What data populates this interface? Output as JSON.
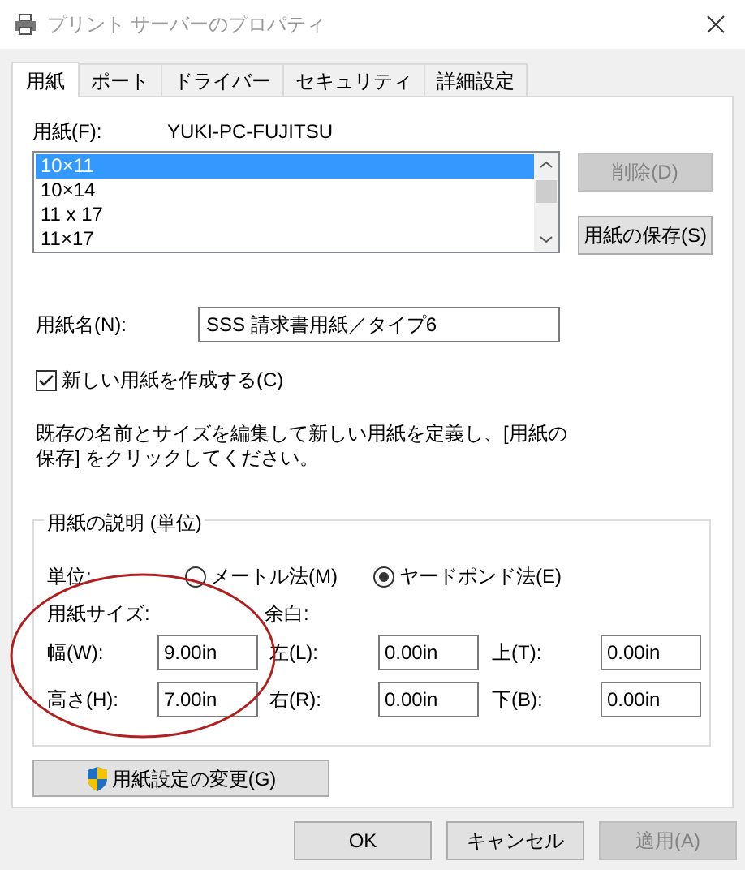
{
  "window": {
    "title": "プリント サーバーのプロパティ"
  },
  "tabs": [
    {
      "label": "用紙",
      "selected": true
    },
    {
      "label": "ポート",
      "selected": false
    },
    {
      "label": "ドライバー",
      "selected": false
    },
    {
      "label": "セキュリティ",
      "selected": false
    },
    {
      "label": "詳細設定",
      "selected": false
    }
  ],
  "paper_forms": {
    "label": "用紙(F):",
    "server": "YUKI-PC-FUJITSU"
  },
  "paper_list": [
    {
      "label": "10×11",
      "selected": true
    },
    {
      "label": "10×14",
      "selected": false
    },
    {
      "label": "11 x 17",
      "selected": false
    },
    {
      "label": "11×17",
      "selected": false
    }
  ],
  "side_buttons": [
    {
      "label": "削除(D)",
      "disabled": true
    },
    {
      "label": "用紙の保存(S)",
      "disabled": false
    }
  ],
  "paper_name": {
    "label": "用紙名(N):",
    "value": "SSS 請求書用紙／タイプ6"
  },
  "create_new": {
    "label": "新しい用紙を作成する(C)",
    "checked": true
  },
  "instructions": "既存の名前とサイズを編集して新しい用紙を定義し、[用紙の保存] をクリックしてください。",
  "description_group": {
    "title": "用紙の説明 (単位)",
    "unit_label": "単位:",
    "units": [
      {
        "label": "メートル法(M)",
        "selected": false
      },
      {
        "label": "ヤードポンド法(E)",
        "selected": true
      }
    ],
    "size_label": "用紙サイズ:",
    "margin_label": "余白:",
    "size_fields": [
      {
        "label": "幅(W):",
        "value": "9.00in"
      },
      {
        "label": "高さ(H):",
        "value": "7.00in"
      }
    ],
    "margin_fields": [
      {
        "label": "左(L):",
        "value": "0.00in"
      },
      {
        "label": "上(T):",
        "value": "0.00in"
      },
      {
        "label": "右(R):",
        "value": "0.00in"
      },
      {
        "label": "下(B):",
        "value": "0.00in"
      }
    ]
  },
  "change_settings_button": {
    "label": "用紙設定の変更(G)"
  },
  "dialog_buttons": [
    {
      "label": "OK",
      "disabled": false
    },
    {
      "label": "キャンセル",
      "disabled": false
    },
    {
      "label": "適用(A)",
      "disabled": true
    }
  ]
}
